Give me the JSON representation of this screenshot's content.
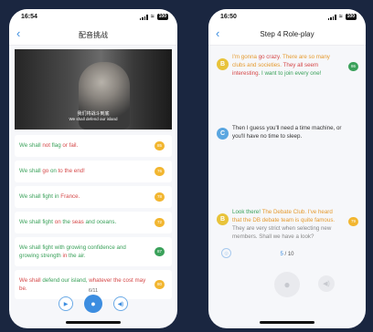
{
  "left": {
    "status": {
      "time": "16:54",
      "battery": "100"
    },
    "title": "配音挑战",
    "video": {
      "subtitle_cn": "我们将战斗到底",
      "subtitle_en": "We shall defend our island"
    },
    "lines": [
      {
        "segments": [
          {
            "t": "We shall ",
            "c": "g"
          },
          {
            "t": "not ",
            "c": "r"
          },
          {
            "t": "flag ",
            "c": "g"
          },
          {
            "t": "or fail.",
            "c": "r"
          }
        ],
        "score": "85",
        "badge": "#f2b630"
      },
      {
        "segments": [
          {
            "t": "We shall ",
            "c": "g"
          },
          {
            "t": "go ",
            "c": "r"
          },
          {
            "t": "on ",
            "c": "g"
          },
          {
            "t": "to the end!",
            "c": "r"
          }
        ],
        "score": "76",
        "badge": "#f2b630"
      },
      {
        "segments": [
          {
            "t": "We shall fight in ",
            "c": "g"
          },
          {
            "t": "France.",
            "c": "r"
          }
        ],
        "score": "78",
        "badge": "#f2b630"
      },
      {
        "segments": [
          {
            "t": "We shall fight ",
            "c": "g"
          },
          {
            "t": "on ",
            "c": "r"
          },
          {
            "t": "the ",
            "c": "g"
          },
          {
            "t": "seas ",
            "c": "r"
          },
          {
            "t": "and oceans.",
            "c": "g"
          }
        ],
        "score": "72",
        "badge": "#f2b630"
      },
      {
        "segments": [
          {
            "t": "We shall fight with growing confidence and growing strength ",
            "c": "g"
          },
          {
            "t": "in ",
            "c": "r"
          },
          {
            "t": "the air.",
            "c": "g"
          }
        ],
        "score": "87",
        "badge": "#3aa15a"
      },
      {
        "segments": [
          {
            "t": "We shall ",
            "c": "r"
          },
          {
            "t": "defend our island, ",
            "c": "g"
          },
          {
            "t": "whatever the cost may be.",
            "c": "r"
          }
        ],
        "score": "80",
        "badge": "#f2b630"
      }
    ],
    "counter": "6/11"
  },
  "right": {
    "status": {
      "time": "16:50",
      "battery": "100"
    },
    "title": "Step 4 Role-play",
    "messages": [
      {
        "role": "B",
        "avatar_color": "#e8c33a",
        "segments": [
          {
            "t": "I'm gonna ",
            "c": "o"
          },
          {
            "t": "go crazy",
            "c": "r"
          },
          {
            "t": ". There are so many clubs and societies. ",
            "c": "o"
          },
          {
            "t": "They all seem interesting",
            "c": "r"
          },
          {
            "t": ". I want to join every one!",
            "c": "g"
          }
        ],
        "score": "86",
        "score_color": "#3aa15a"
      },
      {
        "role": "C",
        "avatar_color": "#5aa6e0",
        "segments": [
          {
            "t": "Then I guess you'll need a time machine, or you'll have no time to sleep.",
            "c": "b"
          }
        ],
        "score": "",
        "score_color": ""
      },
      {
        "role": "B",
        "avatar_color": "#e8c33a",
        "segments": [
          {
            "t": "Look there! ",
            "c": "g"
          },
          {
            "t": "The Debate Club. I've heard that the DB debate team is quite famous. ",
            "c": "o"
          },
          {
            "t": "They are very strict when selecting new members. Shall we have a look?",
            "c": "gr"
          }
        ],
        "score": "79",
        "score_color": "#f2b630"
      }
    ],
    "progress": {
      "current": "5",
      "total": "10"
    }
  }
}
